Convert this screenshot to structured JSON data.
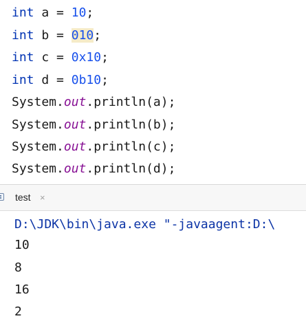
{
  "editor": {
    "lines": [
      {
        "type": "int",
        "name": "a",
        "op": "=",
        "value": "10",
        "end": ";"
      },
      {
        "type": "int",
        "name": "b",
        "op": "=",
        "value": "010",
        "end": ";"
      },
      {
        "type": "int",
        "name": "c",
        "op": "=",
        "value": "0x10",
        "end": ";"
      },
      {
        "type": "int",
        "name": "d",
        "op": "=",
        "value": "0b10",
        "end": ";"
      },
      {
        "prefix": "System.",
        "field": "out",
        "call": ".println(a);"
      },
      {
        "prefix": "System.",
        "field": "out",
        "call": ".println(b);"
      },
      {
        "prefix": "System.",
        "field": "out",
        "call": ".println(c);"
      },
      {
        "prefix": "System.",
        "field": "out",
        "call": ".println(d);"
      }
    ]
  },
  "run_panel": {
    "tab_label": "test",
    "close_glyph": "×",
    "icon": "console-icon"
  },
  "console": {
    "command": "D:\\JDK\\bin\\java.exe \"-javaagent:D:\\",
    "outputs": [
      "10",
      "8",
      "16",
      "2"
    ]
  },
  "colors": {
    "keyword": "#0033b3",
    "number": "#1750eb",
    "field": "#871094",
    "highlight": "#f5ebc8"
  }
}
